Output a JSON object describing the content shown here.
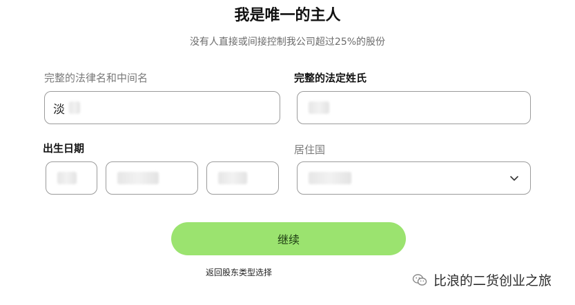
{
  "heading": {
    "title": "我是唯一的主人",
    "subtitle": "没有人直接或间接控制我公司超过25%的股份"
  },
  "form": {
    "given_names_label": "完整的法律名和中间名",
    "given_names_value": "淡",
    "surname_label": "完整的法定姓氏",
    "surname_value": "",
    "dob_label": "出生日期",
    "dob_day_value": "",
    "dob_month_value": "",
    "dob_year_value": "",
    "country_label": "居住国",
    "country_value": ""
  },
  "actions": {
    "continue_label": "继续",
    "back_label": "返回股东类型选择"
  },
  "watermark": {
    "text": "比浪的二货创业之旅",
    "icon": "wechat-icon"
  },
  "colors": {
    "primary_button": "#9be36f",
    "field_border": "#9a9a9a"
  }
}
